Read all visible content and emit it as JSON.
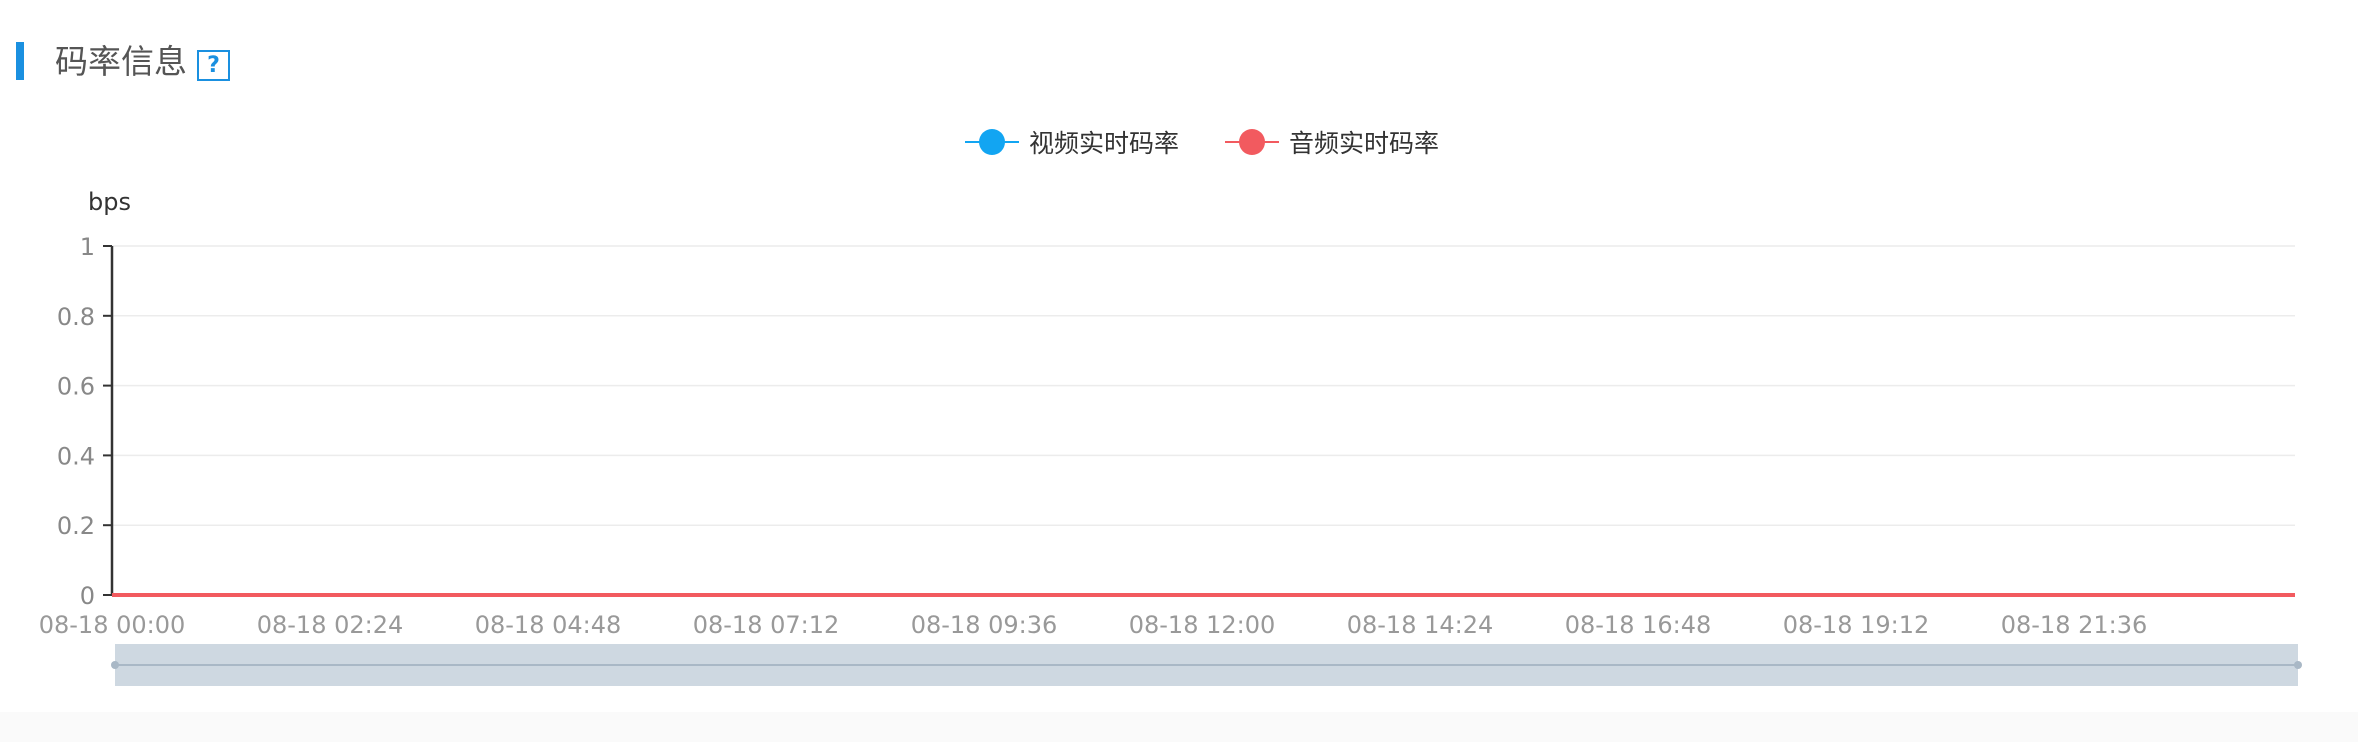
{
  "header": {
    "title": "码率信息",
    "help_label": "?"
  },
  "legend": [
    {
      "label": "视频实时码率",
      "color": "#12a5f2"
    },
    {
      "label": "音频实时码率",
      "color": "#f25a5f"
    }
  ],
  "chart_data": {
    "type": "line",
    "ylabel": "bps",
    "ylim": [
      0,
      1
    ],
    "y_ticks": [
      "0",
      "0.2",
      "0.4",
      "0.6",
      "0.8",
      "1"
    ],
    "x_ticks": [
      "08-18 00:00",
      "08-18 02:24",
      "08-18 04:48",
      "08-18 07:12",
      "08-18 09:36",
      "08-18 12:00",
      "08-18 14:24",
      "08-18 16:48",
      "08-18 19:12",
      "08-18 21:36"
    ],
    "grid": true,
    "legend_position": "top-center",
    "series": [
      {
        "name": "视频实时码率",
        "color": "#12a5f2",
        "values": [
          0,
          0,
          0,
          0,
          0,
          0,
          0,
          0,
          0,
          0
        ]
      },
      {
        "name": "音频实时码率",
        "color": "#f25a5f",
        "values": [
          0,
          0,
          0,
          0,
          0,
          0,
          0,
          0,
          0,
          0
        ]
      }
    ],
    "data_zoom": {
      "start": 0,
      "end": 1
    }
  }
}
